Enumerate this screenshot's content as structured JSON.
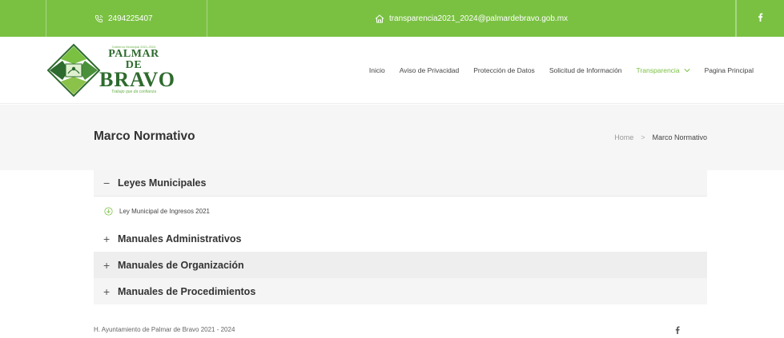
{
  "topbar": {
    "phone": "2494225407",
    "email": "transparencia2021_2024@palmardebravo.gob.mx",
    "icons": {
      "phone": "phone-icon",
      "email": "home-icon",
      "social": "facebook-icon"
    }
  },
  "logo": {
    "small_text": "Gobierno Municipal 2021-2024",
    "line1": "PALMAR DE",
    "line2": "BRAVO",
    "slogan": "Trabajo que da confianza"
  },
  "nav": {
    "items": [
      {
        "label": "Inicio"
      },
      {
        "label": "Aviso de Privacidad"
      },
      {
        "label": "Protección de Datos"
      },
      {
        "label": "Solicitud de Información"
      },
      {
        "label": "Transparencia"
      },
      {
        "label": "Pagina Principal"
      }
    ]
  },
  "title_band": {
    "title": "Marco Normativo",
    "breadcrumb_home": "Home",
    "breadcrumb_sep": ">",
    "breadcrumb_current": "Marco Normativo"
  },
  "accordion": {
    "sections": [
      {
        "symbol": "−",
        "title": "Leyes Municipales",
        "items": [
          "Ley Municipal de Ingresos 2021"
        ]
      },
      {
        "symbol": "+",
        "title": "Manuales Administrativos"
      },
      {
        "symbol": "+",
        "title": "Manuales de Organización"
      },
      {
        "symbol": "+",
        "title": "Manuales de Procedimientos"
      }
    ]
  },
  "footer": {
    "text": "H. Ayuntamiento de Palmar de Bravo 2021 - 2024"
  },
  "colors": {
    "accent": "#7ac142",
    "dark_green": "#2e6b2e",
    "title_band_bg": "#f6f6f6",
    "accordion_bg": "#f5f5f5"
  }
}
